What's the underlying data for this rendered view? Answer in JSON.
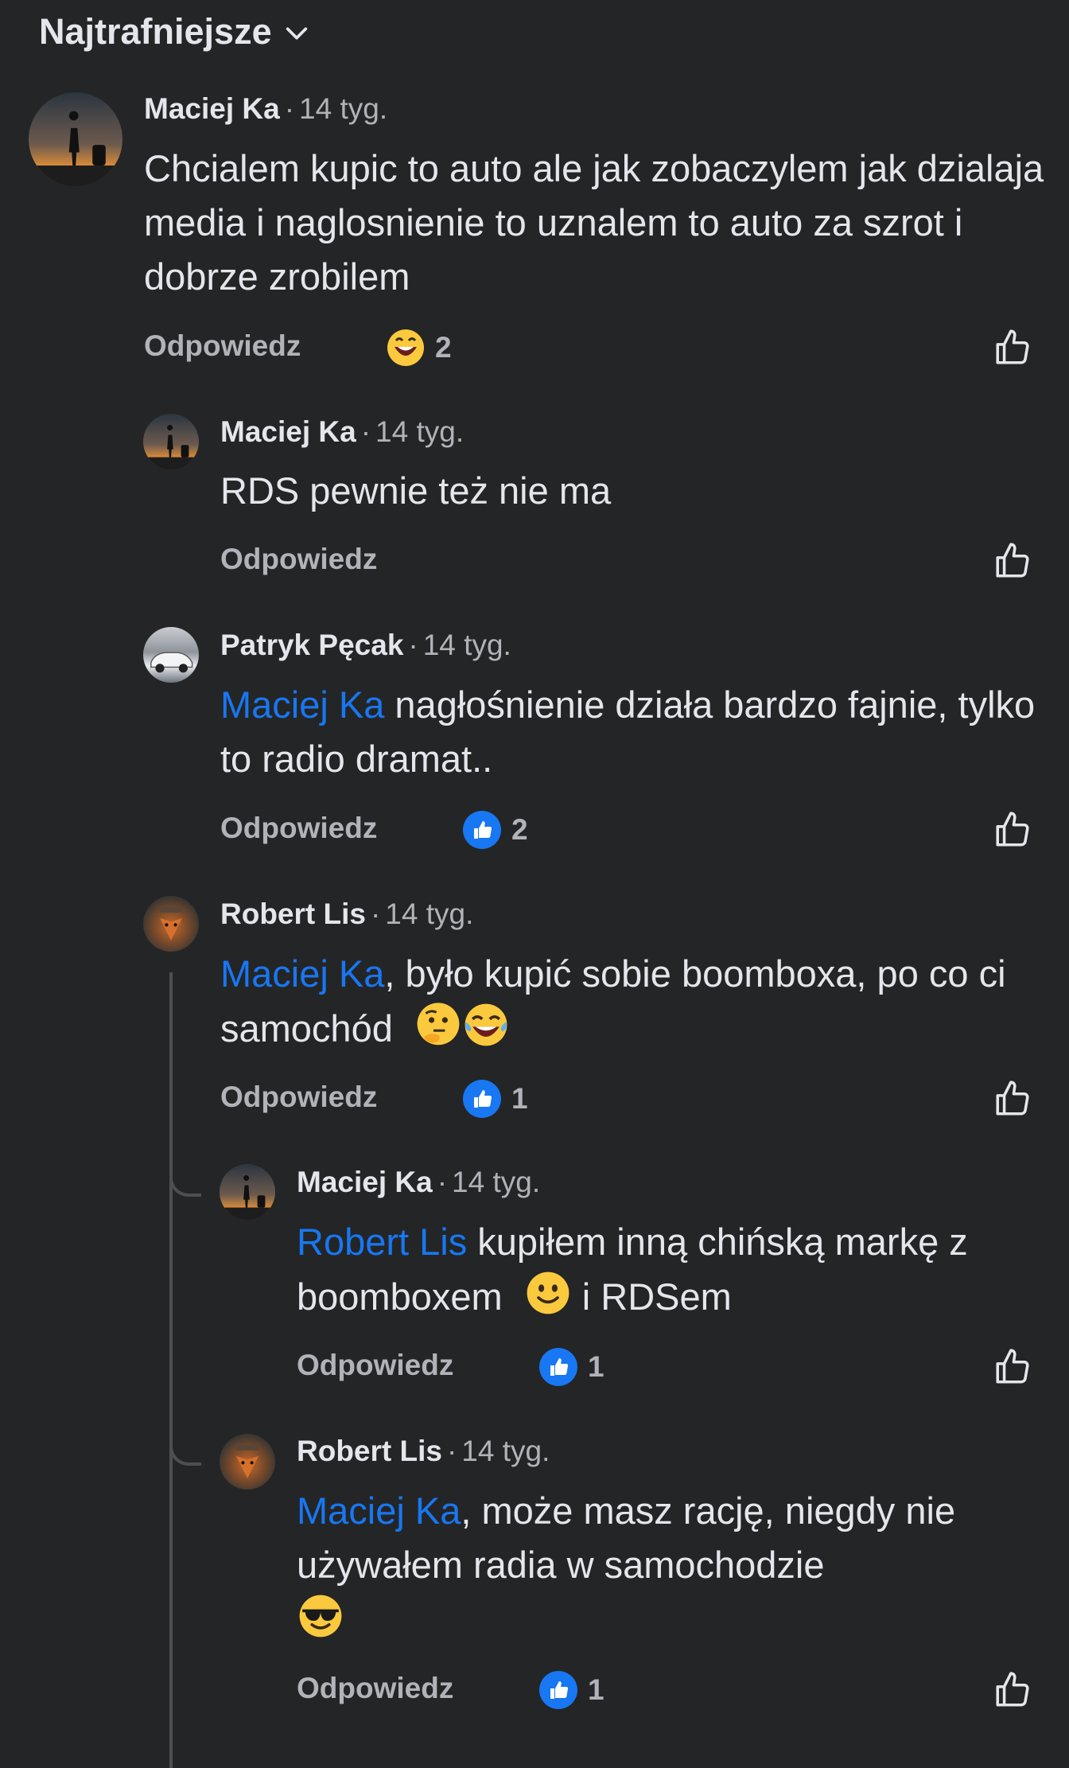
{
  "sort": {
    "label": "Najtrafniejsze"
  },
  "ui": {
    "reply_label": "Odpowiedz",
    "separator": "·"
  },
  "comments": [
    {
      "author": "Maciej Ka",
      "time": "14 tyg.",
      "text": "Chcialem kupic to auto ale jak zobaczylem jak dzialaja media i naglosnienie to uznalem to auto za szrot i dobrze zrobilem",
      "reaction_icon": "grinning-emoji-icon",
      "reaction_count": "2"
    },
    {
      "author": "Maciej Ka",
      "time": "14 tyg.",
      "text": "RDS pewnie też nie ma"
    },
    {
      "author": "Patryk Pęcak",
      "time": "14 tyg.",
      "mention": "Maciej Ka",
      "text": " nagłośnienie działa bardzo fajnie, tylko to radio dramat..",
      "reaction_icon": "like-reaction-icon",
      "reaction_count": "2"
    },
    {
      "author": "Robert Lis",
      "time": "14 tyg.",
      "mention": "Maciej Ka",
      "text": ", było kupić sobie boomboxa, po co ci samochód",
      "emojis": [
        "thinking-emoji-icon",
        "tears-of-joy-emoji-icon"
      ],
      "reaction_icon": "like-reaction-icon",
      "reaction_count": "1"
    },
    {
      "author": "Maciej Ka",
      "time": "14 tyg.",
      "mention": "Robert Lis",
      "text_before_emoji": " kupiłem inną chińską markę z boomboxem",
      "emoji": "smiling-emoji-icon",
      "text_after_emoji": " i RDSem",
      "reaction_icon": "like-reaction-icon",
      "reaction_count": "1"
    },
    {
      "author": "Robert Lis",
      "time": "14 tyg.",
      "mention": "Maciej Ka",
      "text": ", może masz rację, niegdy nie używałem radia w samochodzie",
      "emojis": [
        "sunglasses-emoji-icon"
      ],
      "reaction_icon": "like-reaction-icon",
      "reaction_count": "1"
    }
  ],
  "colors": {
    "background": "#242526",
    "text": "#e4e6eb",
    "secondary": "#b0b3b8",
    "mention": "#1877f2"
  }
}
